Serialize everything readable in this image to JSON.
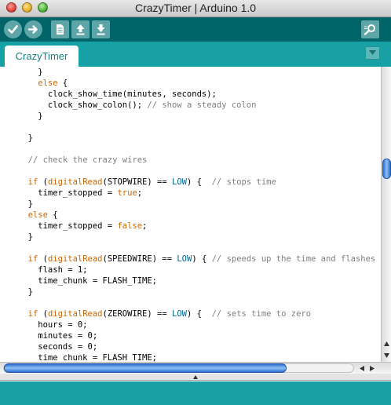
{
  "window": {
    "title": "CrazyTimer | Arduino 1.0"
  },
  "toolbar": {
    "buttons": [
      {
        "name": "verify",
        "icon": "checkmark-icon"
      },
      {
        "name": "upload",
        "icon": "arrow-right-icon"
      },
      {
        "name": "new",
        "icon": "document-icon"
      },
      {
        "name": "open",
        "icon": "arrow-up-icon"
      },
      {
        "name": "save",
        "icon": "arrow-down-icon"
      },
      {
        "name": "serial-monitor",
        "icon": "magnifier-icon"
      }
    ]
  },
  "tabs": [
    {
      "label": "CrazyTimer",
      "active": true
    }
  ],
  "editor": {
    "lines": [
      [
        {
          "t": "    }",
          "c": ""
        }
      ],
      [
        {
          "t": "    ",
          "c": ""
        },
        {
          "t": "else",
          "c": "kw"
        },
        {
          "t": " {",
          "c": ""
        }
      ],
      [
        {
          "t": "      clock_show_time(minutes, seconds);",
          "c": ""
        }
      ],
      [
        {
          "t": "      clock_show_colon(); ",
          "c": ""
        },
        {
          "t": "// show a steady colon",
          "c": "cm"
        }
      ],
      [
        {
          "t": "    }",
          "c": ""
        }
      ],
      [
        {
          "t": "",
          "c": ""
        }
      ],
      [
        {
          "t": "  }",
          "c": ""
        }
      ],
      [
        {
          "t": "",
          "c": ""
        }
      ],
      [
        {
          "t": "  ",
          "c": ""
        },
        {
          "t": "// check the crazy wires",
          "c": "cm"
        }
      ],
      [
        {
          "t": "",
          "c": ""
        }
      ],
      [
        {
          "t": "  ",
          "c": ""
        },
        {
          "t": "if",
          "c": "kw"
        },
        {
          "t": " (",
          "c": ""
        },
        {
          "t": "digitalRead",
          "c": "kw"
        },
        {
          "t": "(STOPWIRE) == ",
          "c": ""
        },
        {
          "t": "LOW",
          "c": "cst"
        },
        {
          "t": ") {  ",
          "c": ""
        },
        {
          "t": "// stops time",
          "c": "cm"
        }
      ],
      [
        {
          "t": "    timer_stopped = ",
          "c": ""
        },
        {
          "t": "true",
          "c": "kw"
        },
        {
          "t": ";",
          "c": ""
        }
      ],
      [
        {
          "t": "  }",
          "c": ""
        }
      ],
      [
        {
          "t": "  ",
          "c": ""
        },
        {
          "t": "else",
          "c": "kw"
        },
        {
          "t": " {",
          "c": ""
        }
      ],
      [
        {
          "t": "    timer_stopped = ",
          "c": ""
        },
        {
          "t": "false",
          "c": "kw"
        },
        {
          "t": ";",
          "c": ""
        }
      ],
      [
        {
          "t": "  }",
          "c": ""
        }
      ],
      [
        {
          "t": "",
          "c": ""
        }
      ],
      [
        {
          "t": "  ",
          "c": ""
        },
        {
          "t": "if",
          "c": "kw"
        },
        {
          "t": " (",
          "c": ""
        },
        {
          "t": "digitalRead",
          "c": "kw"
        },
        {
          "t": "(SPEEDWIRE) == ",
          "c": ""
        },
        {
          "t": "LOW",
          "c": "cst"
        },
        {
          "t": ") { ",
          "c": ""
        },
        {
          "t": "// speeds up the time and flashes displ",
          "c": "cm"
        }
      ],
      [
        {
          "t": "    flash = 1;",
          "c": ""
        }
      ],
      [
        {
          "t": "    time_chunk = FLASH_TIME;",
          "c": ""
        }
      ],
      [
        {
          "t": "  }",
          "c": ""
        }
      ],
      [
        {
          "t": "",
          "c": ""
        }
      ],
      [
        {
          "t": "  ",
          "c": ""
        },
        {
          "t": "if",
          "c": "kw"
        },
        {
          "t": " (",
          "c": ""
        },
        {
          "t": "digitalRead",
          "c": "kw"
        },
        {
          "t": "(ZEROWIRE) == ",
          "c": ""
        },
        {
          "t": "LOW",
          "c": "cst"
        },
        {
          "t": ") {  ",
          "c": ""
        },
        {
          "t": "// sets time to zero",
          "c": "cm"
        }
      ],
      [
        {
          "t": "    hours = 0;",
          "c": ""
        }
      ],
      [
        {
          "t": "    minutes = 0;",
          "c": ""
        }
      ],
      [
        {
          "t": "    seconds = 0;",
          "c": ""
        }
      ],
      [
        {
          "t": "    time_chunk = FLASH_TIME;",
          "c": ""
        }
      ]
    ]
  },
  "colors": {
    "toolbar": "#006468",
    "tabbar": "#17a1a5",
    "keyword": "#cc6600",
    "constant": "#006699",
    "comment": "#7e7e7e"
  }
}
